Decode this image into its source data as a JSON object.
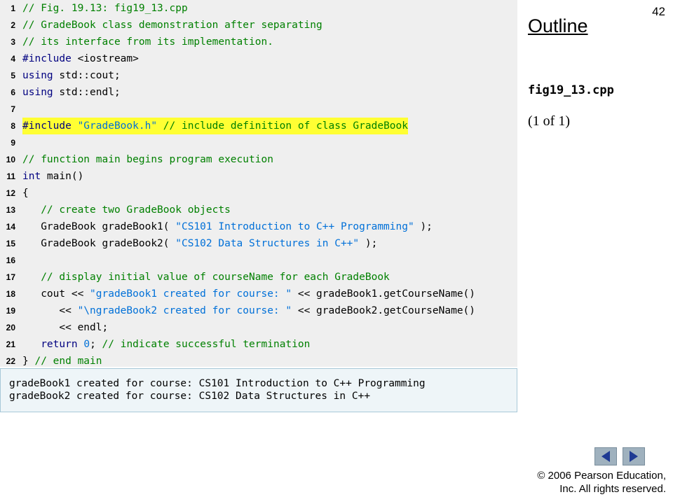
{
  "slide": {
    "page_number": "42",
    "outline_title": "Outline",
    "file_name": "fig19_13.cpp",
    "page_of": "(1 of 1)",
    "copyright_line1": "© 2006 Pearson Education,",
    "copyright_line2": "Inc.  All rights reserved."
  },
  "code": {
    "lines": [
      {
        "n": "1",
        "segs": [
          {
            "t": "// Fig. 19.13: fig19_13.cpp",
            "c": "cm"
          }
        ]
      },
      {
        "n": "2",
        "segs": [
          {
            "t": "// GradeBook class demonstration after separating",
            "c": "cm"
          }
        ]
      },
      {
        "n": "3",
        "segs": [
          {
            "t": "// its interface from its implementation.",
            "c": "cm"
          }
        ]
      },
      {
        "n": "4",
        "segs": [
          {
            "t": "#include",
            "c": "kw"
          },
          {
            "t": " <iostream>",
            "c": "pl"
          }
        ]
      },
      {
        "n": "5",
        "segs": [
          {
            "t": "using",
            "c": "kw"
          },
          {
            "t": " std::cout;",
            "c": "pl"
          }
        ]
      },
      {
        "n": "6",
        "segs": [
          {
            "t": "using",
            "c": "kw"
          },
          {
            "t": " std::endl;",
            "c": "pl"
          }
        ]
      },
      {
        "n": "7",
        "segs": []
      },
      {
        "n": "8",
        "hl": true,
        "segs": [
          {
            "t": "#include",
            "c": "kw"
          },
          {
            "t": " ",
            "c": "pl"
          },
          {
            "t": "\"GradeBook.h\"",
            "c": "st"
          },
          {
            "t": " // include definition of class GradeBook",
            "c": "cm"
          }
        ]
      },
      {
        "n": "9",
        "segs": []
      },
      {
        "n": "10",
        "segs": [
          {
            "t": "// function main begins program execution",
            "c": "cm"
          }
        ]
      },
      {
        "n": "11",
        "segs": [
          {
            "t": "int",
            "c": "kw"
          },
          {
            "t": " main()",
            "c": "pl"
          }
        ]
      },
      {
        "n": "12",
        "segs": [
          {
            "t": "{",
            "c": "pl"
          }
        ]
      },
      {
        "n": "13",
        "segs": [
          {
            "t": "   // create two GradeBook objects",
            "c": "cm"
          }
        ]
      },
      {
        "n": "14",
        "segs": [
          {
            "t": "   GradeBook gradeBook1( ",
            "c": "pl"
          },
          {
            "t": "\"CS101 Introduction to C++ Programming\"",
            "c": "st"
          },
          {
            "t": " );",
            "c": "pl"
          }
        ]
      },
      {
        "n": "15",
        "segs": [
          {
            "t": "   GradeBook gradeBook2( ",
            "c": "pl"
          },
          {
            "t": "\"CS102 Data Structures in C++\"",
            "c": "st"
          },
          {
            "t": " );",
            "c": "pl"
          }
        ]
      },
      {
        "n": "16",
        "segs": []
      },
      {
        "n": "17",
        "segs": [
          {
            "t": "   // display initial value of courseName for each GradeBook",
            "c": "cm"
          }
        ]
      },
      {
        "n": "18",
        "segs": [
          {
            "t": "   cout << ",
            "c": "pl"
          },
          {
            "t": "\"gradeBook1 created for course: \"",
            "c": "st"
          },
          {
            "t": " << gradeBook1.getCourseName()",
            "c": "pl"
          }
        ]
      },
      {
        "n": "19",
        "segs": [
          {
            "t": "      << ",
            "c": "pl"
          },
          {
            "t": "\"\\ngradeBook2 created for course: \"",
            "c": "st"
          },
          {
            "t": " << gradeBook2.getCourseName()",
            "c": "pl"
          }
        ]
      },
      {
        "n": "20",
        "segs": [
          {
            "t": "      << endl;",
            "c": "pl"
          }
        ]
      },
      {
        "n": "21",
        "segs": [
          {
            "t": "   ",
            "c": "pl"
          },
          {
            "t": "return",
            "c": "kw"
          },
          {
            "t": " ",
            "c": "pl"
          },
          {
            "t": "0",
            "c": "nm"
          },
          {
            "t": "; ",
            "c": "pl"
          },
          {
            "t": "// indicate successful termination",
            "c": "cm"
          }
        ]
      },
      {
        "n": "22",
        "segs": [
          {
            "t": "} ",
            "c": "pl"
          },
          {
            "t": "// end main",
            "c": "cm"
          }
        ]
      }
    ]
  },
  "output": {
    "lines": [
      "gradeBook1 created for course: CS101 Introduction to C++ Programming",
      "gradeBook2 created for course: CS102 Data Structures in C++"
    ]
  },
  "nav": {
    "prev_icon": "triangle-left-icon",
    "next_icon": "triangle-right-icon",
    "button_color": "#9fb1be",
    "arrow_color": "#1f3a93"
  },
  "colors": {
    "comment": "#008000",
    "keyword": "#000080",
    "string": "#0070d8",
    "highlight": "#ffff33",
    "code_background": "#efefef",
    "output_background": "#eef5f8"
  }
}
